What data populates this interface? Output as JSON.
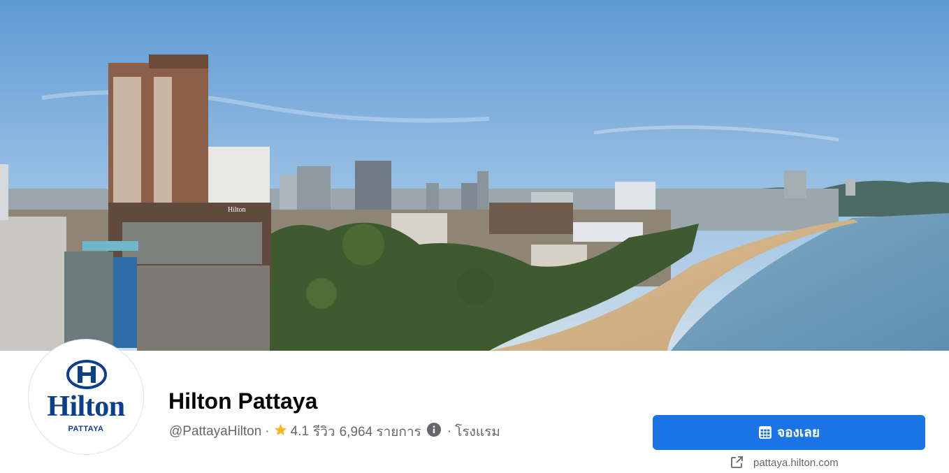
{
  "page": {
    "name": "Hilton Pattaya",
    "handle": "@PattayaHilton",
    "rating": "4.1",
    "reviews_label": "รีวิว",
    "reviews_count": "6,964 รายการ",
    "category": "โรงแรม",
    "separator": "·"
  },
  "logo": {
    "brand": "Hilton",
    "location": "PATTAYA",
    "color": "#0b3f8c"
  },
  "actions": {
    "book_label": "จองเลย",
    "book_color": "#1b74e4",
    "website": "pattaya.hilton.com"
  },
  "cover": {
    "building_sign": "Hilton"
  },
  "icons": {
    "rating": "star-icon",
    "info": "info-icon",
    "book": "calendar-icon",
    "website": "external-link-icon"
  }
}
